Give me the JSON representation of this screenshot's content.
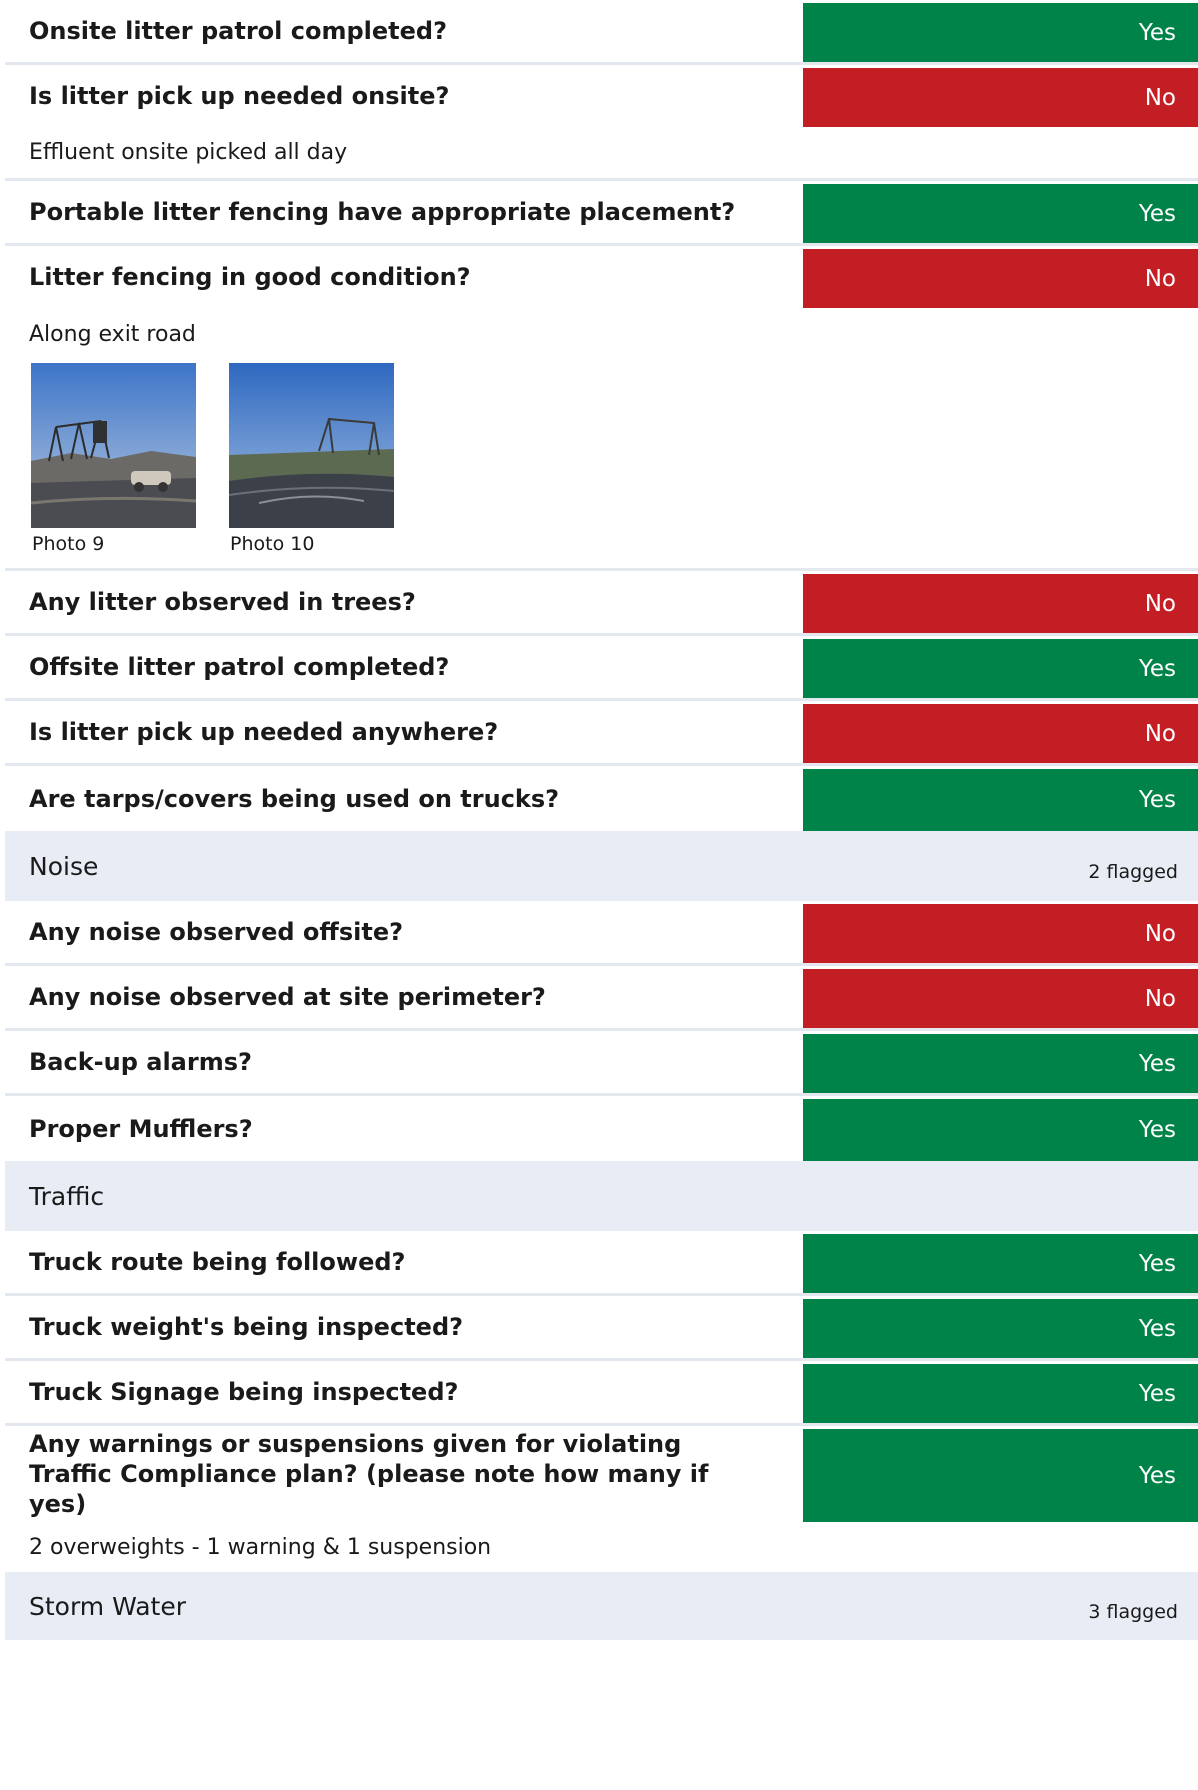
{
  "colors": {
    "yes": "#008348",
    "no": "#c41e25",
    "section_bg": "#e8edf5",
    "divider": "#e3e7ee"
  },
  "rows": [
    {
      "question": "Onsite litter patrol completed?",
      "answer": "Yes"
    },
    {
      "question": "Is litter pick up needed onsite?",
      "answer": "No",
      "note": "Effluent onsite picked all day"
    },
    {
      "question": "Portable litter fencing have appropriate placement?",
      "answer": "Yes"
    },
    {
      "question": "Litter fencing in good condition?",
      "answer": "No",
      "note": "Along exit road",
      "photos": [
        "Photo 9",
        "Photo 10"
      ]
    },
    {
      "question": "Any litter observed in trees?",
      "answer": "No"
    },
    {
      "question": "Offsite litter patrol completed?",
      "answer": "Yes"
    },
    {
      "question": "Is litter pick up needed anywhere?",
      "answer": "No"
    },
    {
      "question": "Are tarps/covers being used on trucks?",
      "answer": "Yes"
    }
  ],
  "noise": {
    "title": "Noise",
    "flagged": "2 flagged",
    "rows": [
      {
        "question": "Any noise observed offsite?",
        "answer": "No"
      },
      {
        "question": "Any noise observed at site perimeter?",
        "answer": "No"
      },
      {
        "question": "Back-up alarms?",
        "answer": "Yes"
      },
      {
        "question": "Proper Mufflers?",
        "answer": "Yes"
      }
    ]
  },
  "traffic": {
    "title": "Traffic",
    "rows": [
      {
        "question": "Truck route being followed?",
        "answer": "Yes"
      },
      {
        "question": "Truck weight's being inspected?",
        "answer": "Yes"
      },
      {
        "question": "Truck Signage being inspected?",
        "answer": "Yes"
      },
      {
        "question": "Any warnings or suspensions given for violating Traffic Compliance plan? (please note how many if yes)",
        "answer": "Yes",
        "note": "2 overweights - 1 warning & 1 suspension"
      }
    ]
  },
  "storm_water": {
    "title": "Storm Water",
    "flagged": "3 flagged"
  }
}
